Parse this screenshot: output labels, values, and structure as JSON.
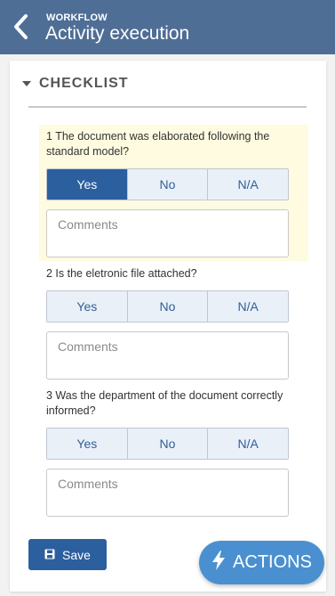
{
  "header": {
    "subtitle": "WORKFLOW",
    "title": "Activity execution"
  },
  "section": {
    "title": "CHECKLIST"
  },
  "questions": [
    {
      "text": "1 The document was elaborated following the standard model?",
      "options": [
        "Yes",
        "No",
        "N/A"
      ],
      "selected": "Yes",
      "comment_placeholder": "Comments"
    },
    {
      "text": "2 Is the eletronic file attached?",
      "options": [
        "Yes",
        "No",
        "N/A"
      ],
      "selected": "",
      "comment_placeholder": "Comments"
    },
    {
      "text": "3 Was the department of the document correctly informed?",
      "options": [
        "Yes",
        "No",
        "N/A"
      ],
      "selected": "",
      "comment_placeholder": "Comments"
    }
  ],
  "buttons": {
    "save_label": "Save",
    "actions_label": "ACTIONS"
  },
  "colors": {
    "header": "#4f6e96",
    "primary": "#2c5f9e",
    "fab": "#4a90d0",
    "highlight": "#fffbe0"
  }
}
